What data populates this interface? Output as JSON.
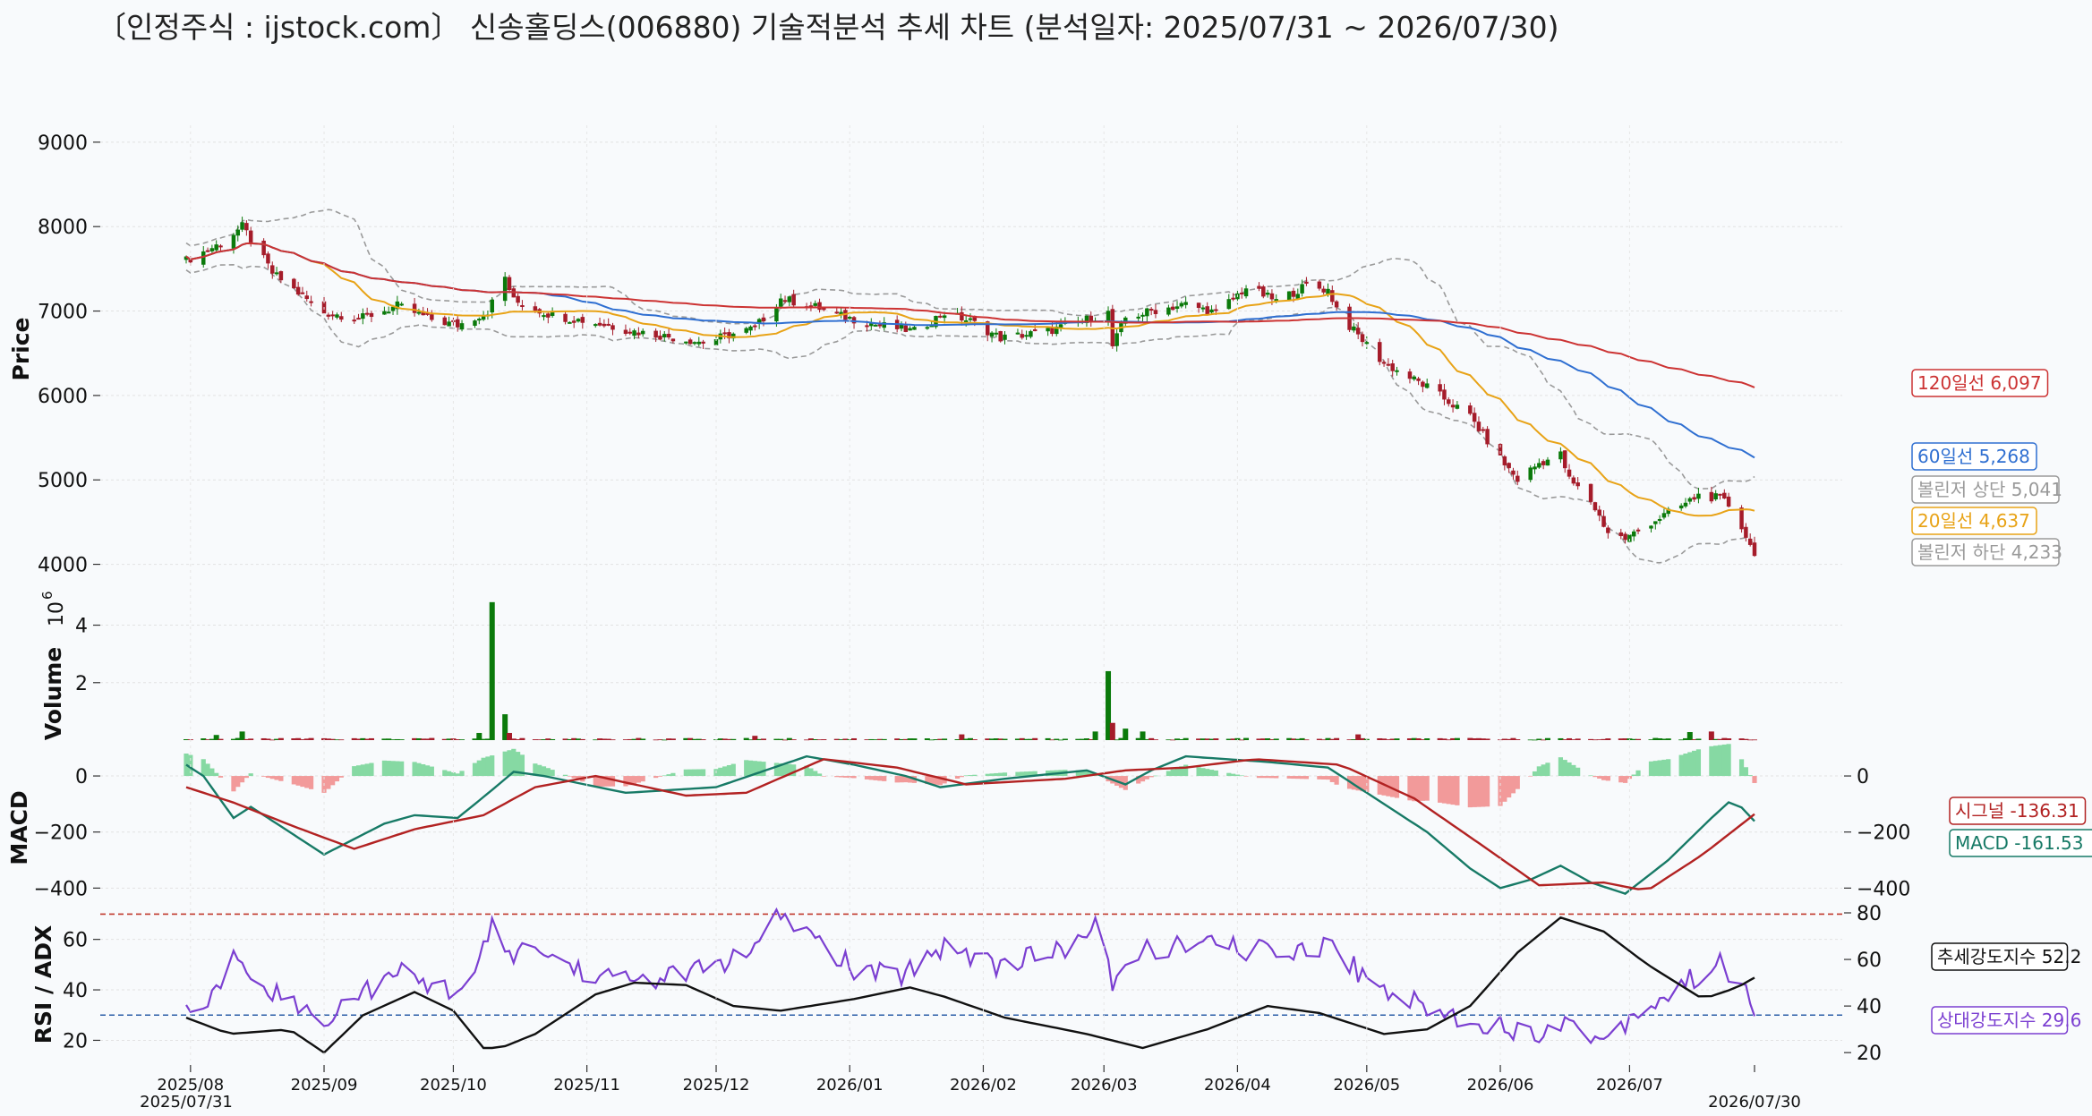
{
  "title": "〔인정주식 : ijstock.com〕 신송홀딩스(006880) 기술적분석 추세 차트 (분석일자: 2025/07/31 ~ 2026/07/30)",
  "colors": {
    "up": "#0b7a0b",
    "down": "#a51c2a",
    "ma20": "#e8a317",
    "ma60": "#2f6fd1",
    "ma120": "#cc3333",
    "bollinger": "#9a9a9a",
    "macd": "#177a66",
    "signal": "#b22222",
    "hist_pos": "#86d9a3",
    "hist_neg": "#f29a9a",
    "rsi": "#7b3fd1",
    "adx": "#111111",
    "overbought": "#c0392b",
    "oversold": "#2c5fa8"
  },
  "chart_data": [
    {
      "type": "candlestick",
      "ylabel": "Price",
      "ylim": [
        3900,
        9200
      ],
      "yticks": [
        4000,
        5000,
        6000,
        7000,
        8000,
        9000
      ],
      "x_start": "2025/07/31",
      "x_end": "2026/07/30",
      "x_tick_labels": [
        "2025/08",
        "2025/09",
        "2025/10",
        "2025/11",
        "2025/12",
        "2026/01",
        "2026/02",
        "2026/03",
        "2026/04",
        "2026/05",
        "2026/06",
        "2026/07"
      ],
      "x_tick_dates": [
        "2025-08-01",
        "2025-09-01",
        "2025-10-01",
        "2025-11-01",
        "2025-12-01",
        "2026-01-01",
        "2026-02-01",
        "2026-03-01",
        "2026-04-01",
        "2026-05-01",
        "2026-06-01",
        "2026-07-01"
      ],
      "x_edge_labels": [
        "2025/07/31",
        "2026/07/30"
      ],
      "close_keypoints": [
        [
          "2025-07-31",
          7600
        ],
        [
          "2025-08-08",
          7800
        ],
        [
          "2025-08-13",
          8000
        ],
        [
          "2025-08-20",
          7450
        ],
        [
          "2025-09-01",
          6980
        ],
        [
          "2025-09-10",
          6920
        ],
        [
          "2025-09-18",
          7060
        ],
        [
          "2025-09-26",
          6900
        ],
        [
          "2025-10-02",
          6830
        ],
        [
          "2025-10-09",
          7000
        ],
        [
          "2025-10-13",
          7400
        ],
        [
          "2025-10-15",
          7120
        ],
        [
          "2025-10-24",
          6950
        ],
        [
          "2025-11-01",
          6880
        ],
        [
          "2025-11-12",
          6760
        ],
        [
          "2025-11-28",
          6630
        ],
        [
          "2025-12-10",
          6800
        ],
        [
          "2025-12-16",
          7150
        ],
        [
          "2025-12-24",
          7050
        ],
        [
          "2025-12-30",
          6940
        ],
        [
          "2026-01-08",
          6830
        ],
        [
          "2026-01-16",
          6760
        ],
        [
          "2026-01-23",
          6980
        ],
        [
          "2026-01-29",
          6880
        ],
        [
          "2026-02-05",
          6680
        ],
        [
          "2026-02-16",
          6760
        ],
        [
          "2026-02-25",
          6900
        ],
        [
          "2026-03-02",
          6980
        ],
        [
          "2026-03-03",
          6580
        ],
        [
          "2026-03-06",
          6920
        ],
        [
          "2026-03-12",
          7000
        ],
        [
          "2026-03-20",
          7080
        ],
        [
          "2026-03-27",
          6980
        ],
        [
          "2026-04-03",
          7280
        ],
        [
          "2026-04-10",
          7120
        ],
        [
          "2026-04-17",
          7300
        ],
        [
          "2026-04-22",
          7250
        ],
        [
          "2026-04-25",
          6930
        ],
        [
          "2026-05-05",
          6380
        ],
        [
          "2026-05-15",
          6100
        ],
        [
          "2026-05-25",
          5750
        ],
        [
          "2026-06-01",
          5250
        ],
        [
          "2026-06-05",
          5000
        ],
        [
          "2026-06-10",
          5200
        ],
        [
          "2026-06-15",
          5300
        ],
        [
          "2026-06-17",
          5000
        ],
        [
          "2026-06-22",
          4750
        ],
        [
          "2026-06-26",
          4380
        ],
        [
          "2026-06-30",
          4300
        ],
        [
          "2026-07-06",
          4500
        ],
        [
          "2026-07-09",
          4580
        ],
        [
          "2026-07-14",
          4720
        ],
        [
          "2026-07-17",
          4820
        ],
        [
          "2026-07-22",
          4780
        ],
        [
          "2026-07-24",
          4700
        ],
        [
          "2026-07-27",
          4450
        ],
        [
          "2026-07-30",
          4100
        ]
      ],
      "last_close": 4100,
      "series": [
        {
          "name": "20일선",
          "last": 4637,
          "label": "20일선 4,637"
        },
        {
          "name": "60일선",
          "last": 5268,
          "label": "60일선 5,268"
        },
        {
          "name": "120일선",
          "last": 6097,
          "label": "120일선 6,097"
        },
        {
          "name": "볼린저 상단",
          "last": 5041,
          "label": "볼린저 상단 5,041"
        },
        {
          "name": "볼린저 하단",
          "last": 4233,
          "label": "볼린저 하단 4,233"
        }
      ]
    },
    {
      "type": "bar",
      "ylabel": "Volume",
      "exponent_label": "10",
      "exponent_power": "6",
      "ylim": [
        0,
        5200000
      ],
      "yticks": [
        2,
        4
      ],
      "spikes": [
        [
          "2025-08-07",
          180000
        ],
        [
          "2025-08-13",
          300000
        ],
        [
          "2025-10-07",
          250000
        ],
        [
          "2025-10-10",
          4800000
        ],
        [
          "2025-10-13",
          900000
        ],
        [
          "2025-10-14",
          250000
        ],
        [
          "2025-12-10",
          150000
        ],
        [
          "2026-01-27",
          200000
        ],
        [
          "2026-02-27",
          300000
        ],
        [
          "2026-03-02",
          2400000
        ],
        [
          "2026-03-03",
          600000
        ],
        [
          "2026-03-06",
          400000
        ],
        [
          "2026-03-10",
          300000
        ],
        [
          "2026-04-29",
          200000
        ],
        [
          "2026-07-15",
          280000
        ],
        [
          "2026-07-20",
          300000
        ]
      ]
    },
    {
      "type": "line",
      "ylabel": "MACD",
      "ylim": [
        -450,
        80
      ],
      "yticks_left": [
        0,
        -200,
        -400
      ],
      "yticks_right": [
        0,
        -200,
        -400
      ],
      "macd_keypoints": [
        [
          "2025-07-31",
          40
        ],
        [
          "2025-08-04",
          0
        ],
        [
          "2025-08-11",
          -150
        ],
        [
          "2025-08-15",
          -110
        ],
        [
          "2025-09-01",
          -280
        ],
        [
          "2025-09-15",
          -170
        ],
        [
          "2025-09-22",
          -140
        ],
        [
          "2025-10-02",
          -150
        ],
        [
          "2025-10-10",
          -50
        ],
        [
          "2025-10-15",
          15
        ],
        [
          "2025-10-22",
          0
        ],
        [
          "2025-11-10",
          -60
        ],
        [
          "2025-12-01",
          -40
        ],
        [
          "2025-12-22",
          70
        ],
        [
          "2026-01-02",
          40
        ],
        [
          "2026-01-14",
          0
        ],
        [
          "2026-01-22",
          -40
        ],
        [
          "2026-02-06",
          -10
        ],
        [
          "2026-02-25",
          20
        ],
        [
          "2026-03-06",
          -30
        ],
        [
          "2026-03-12",
          20
        ],
        [
          "2026-03-20",
          70
        ],
        [
          "2026-04-08",
          50
        ],
        [
          "2026-04-22",
          30
        ],
        [
          "2026-05-05",
          -100
        ],
        [
          "2026-05-15",
          -200
        ],
        [
          "2026-05-25",
          -330
        ],
        [
          "2026-06-01",
          -400
        ],
        [
          "2026-06-08",
          -370
        ],
        [
          "2026-06-15",
          -320
        ],
        [
          "2026-06-22",
          -380
        ],
        [
          "2026-06-30",
          -420
        ],
        [
          "2026-07-10",
          -300
        ],
        [
          "2026-07-20",
          -150
        ],
        [
          "2026-07-25",
          -80
        ],
        [
          "2026-07-30",
          -161.53
        ]
      ],
      "signal_keypoints": [
        [
          "2025-07-31",
          -40
        ],
        [
          "2025-08-11",
          -95
        ],
        [
          "2025-08-25",
          -180
        ],
        [
          "2025-09-08",
          -260
        ],
        [
          "2025-09-22",
          -190
        ],
        [
          "2025-10-08",
          -140
        ],
        [
          "2025-10-20",
          -40
        ],
        [
          "2025-11-03",
          0
        ],
        [
          "2025-11-24",
          -70
        ],
        [
          "2025-12-08",
          -60
        ],
        [
          "2025-12-26",
          60
        ],
        [
          "2026-01-12",
          30
        ],
        [
          "2026-01-28",
          -30
        ],
        [
          "2026-02-20",
          -10
        ],
        [
          "2026-03-06",
          20
        ],
        [
          "2026-03-20",
          30
        ],
        [
          "2026-04-05",
          60
        ],
        [
          "2026-04-25",
          40
        ],
        [
          "2026-05-12",
          -80
        ],
        [
          "2026-05-28",
          -250
        ],
        [
          "2026-06-10",
          -390
        ],
        [
          "2026-06-25",
          -380
        ],
        [
          "2026-07-05",
          -410
        ],
        [
          "2026-07-18",
          -280
        ],
        [
          "2026-07-30",
          -136.31
        ]
      ],
      "series": [
        {
          "name": "시그널",
          "last": -136.31,
          "label": "시그널 -136.31"
        },
        {
          "name": "MACD",
          "last": -161.53,
          "label": "MACD -161.53"
        }
      ]
    },
    {
      "type": "line",
      "ylabel": "RSI / ADX",
      "ylim_left": [
        12,
        73
      ],
      "yticks_left": [
        20,
        40,
        60
      ],
      "yticks_right": [
        20,
        40,
        60,
        80
      ],
      "overbought": 70,
      "oversold": 30,
      "rsi_keypoints": [
        [
          "2025-07-31",
          35
        ],
        [
          "2025-08-03",
          28
        ],
        [
          "2025-08-12",
          55
        ],
        [
          "2025-08-16",
          45
        ],
        [
          "2025-08-26",
          33
        ],
        [
          "2025-09-01",
          28
        ],
        [
          "2025-09-08",
          38
        ],
        [
          "2025-09-20",
          47
        ],
        [
          "2025-09-28",
          40
        ],
        [
          "2025-10-05",
          42
        ],
        [
          "2025-10-10",
          64
        ],
        [
          "2025-10-13",
          55
        ],
        [
          "2025-10-22",
          55
        ],
        [
          "2025-10-30",
          48
        ],
        [
          "2025-11-08",
          44
        ],
        [
          "2025-11-20",
          45
        ],
        [
          "2025-12-01",
          50
        ],
        [
          "2025-12-10",
          55
        ],
        [
          "2025-12-16",
          70
        ],
        [
          "2025-12-24",
          60
        ],
        [
          "2026-01-02",
          48
        ],
        [
          "2026-01-12",
          45
        ],
        [
          "2026-01-23",
          58
        ],
        [
          "2026-02-04",
          50
        ],
        [
          "2026-02-18",
          55
        ],
        [
          "2026-02-27",
          65
        ],
        [
          "2026-03-03",
          42
        ],
        [
          "2026-03-10",
          56
        ],
        [
          "2026-03-24",
          58
        ],
        [
          "2026-04-08",
          55
        ],
        [
          "2026-04-23",
          58
        ],
        [
          "2026-05-01",
          44
        ],
        [
          "2026-05-12",
          35
        ],
        [
          "2026-05-20",
          30
        ],
        [
          "2026-06-01",
          26
        ],
        [
          "2026-06-08",
          22
        ],
        [
          "2026-06-15",
          28
        ],
        [
          "2026-06-25",
          20
        ],
        [
          "2026-07-03",
          32
        ],
        [
          "2026-07-10",
          38
        ],
        [
          "2026-07-17",
          46
        ],
        [
          "2026-07-22",
          50
        ],
        [
          "2026-07-27",
          42
        ],
        [
          "2026-07-30",
          29.6
        ]
      ],
      "adx_keypoints": [
        [
          "2025-07-31",
          35
        ],
        [
          "2025-08-10",
          28
        ],
        [
          "2025-08-24",
          30
        ],
        [
          "2025-09-01",
          20
        ],
        [
          "2025-09-10",
          36
        ],
        [
          "2025-09-22",
          46
        ],
        [
          "2025-10-01",
          38
        ],
        [
          "2025-10-08",
          22
        ],
        [
          "2025-10-12",
          22
        ],
        [
          "2025-10-20",
          28
        ],
        [
          "2025-11-03",
          45
        ],
        [
          "2025-11-12",
          50
        ],
        [
          "2025-11-24",
          49
        ],
        [
          "2025-12-05",
          40
        ],
        [
          "2025-12-16",
          38
        ],
        [
          "2026-01-02",
          43
        ],
        [
          "2026-01-15",
          48
        ],
        [
          "2026-01-23",
          44
        ],
        [
          "2026-02-06",
          35
        ],
        [
          "2026-02-25",
          28
        ],
        [
          "2026-03-10",
          22
        ],
        [
          "2026-03-25",
          30
        ],
        [
          "2026-04-08",
          40
        ],
        [
          "2026-04-20",
          37
        ],
        [
          "2026-05-05",
          28
        ],
        [
          "2026-05-15",
          30
        ],
        [
          "2026-05-25",
          40
        ],
        [
          "2026-06-05",
          63
        ],
        [
          "2026-06-15",
          78
        ],
        [
          "2026-06-25",
          72
        ],
        [
          "2026-07-05",
          58
        ],
        [
          "2026-07-18",
          43
        ],
        [
          "2026-07-26",
          48
        ],
        [
          "2026-07-30",
          52.2
        ]
      ],
      "series": [
        {
          "name": "추세강도지수",
          "last": 52.2,
          "label": "추세강도지수 52.2"
        },
        {
          "name": "상대강도지수",
          "last": 29.6,
          "label": "상대강도지수 29.6"
        }
      ]
    }
  ]
}
